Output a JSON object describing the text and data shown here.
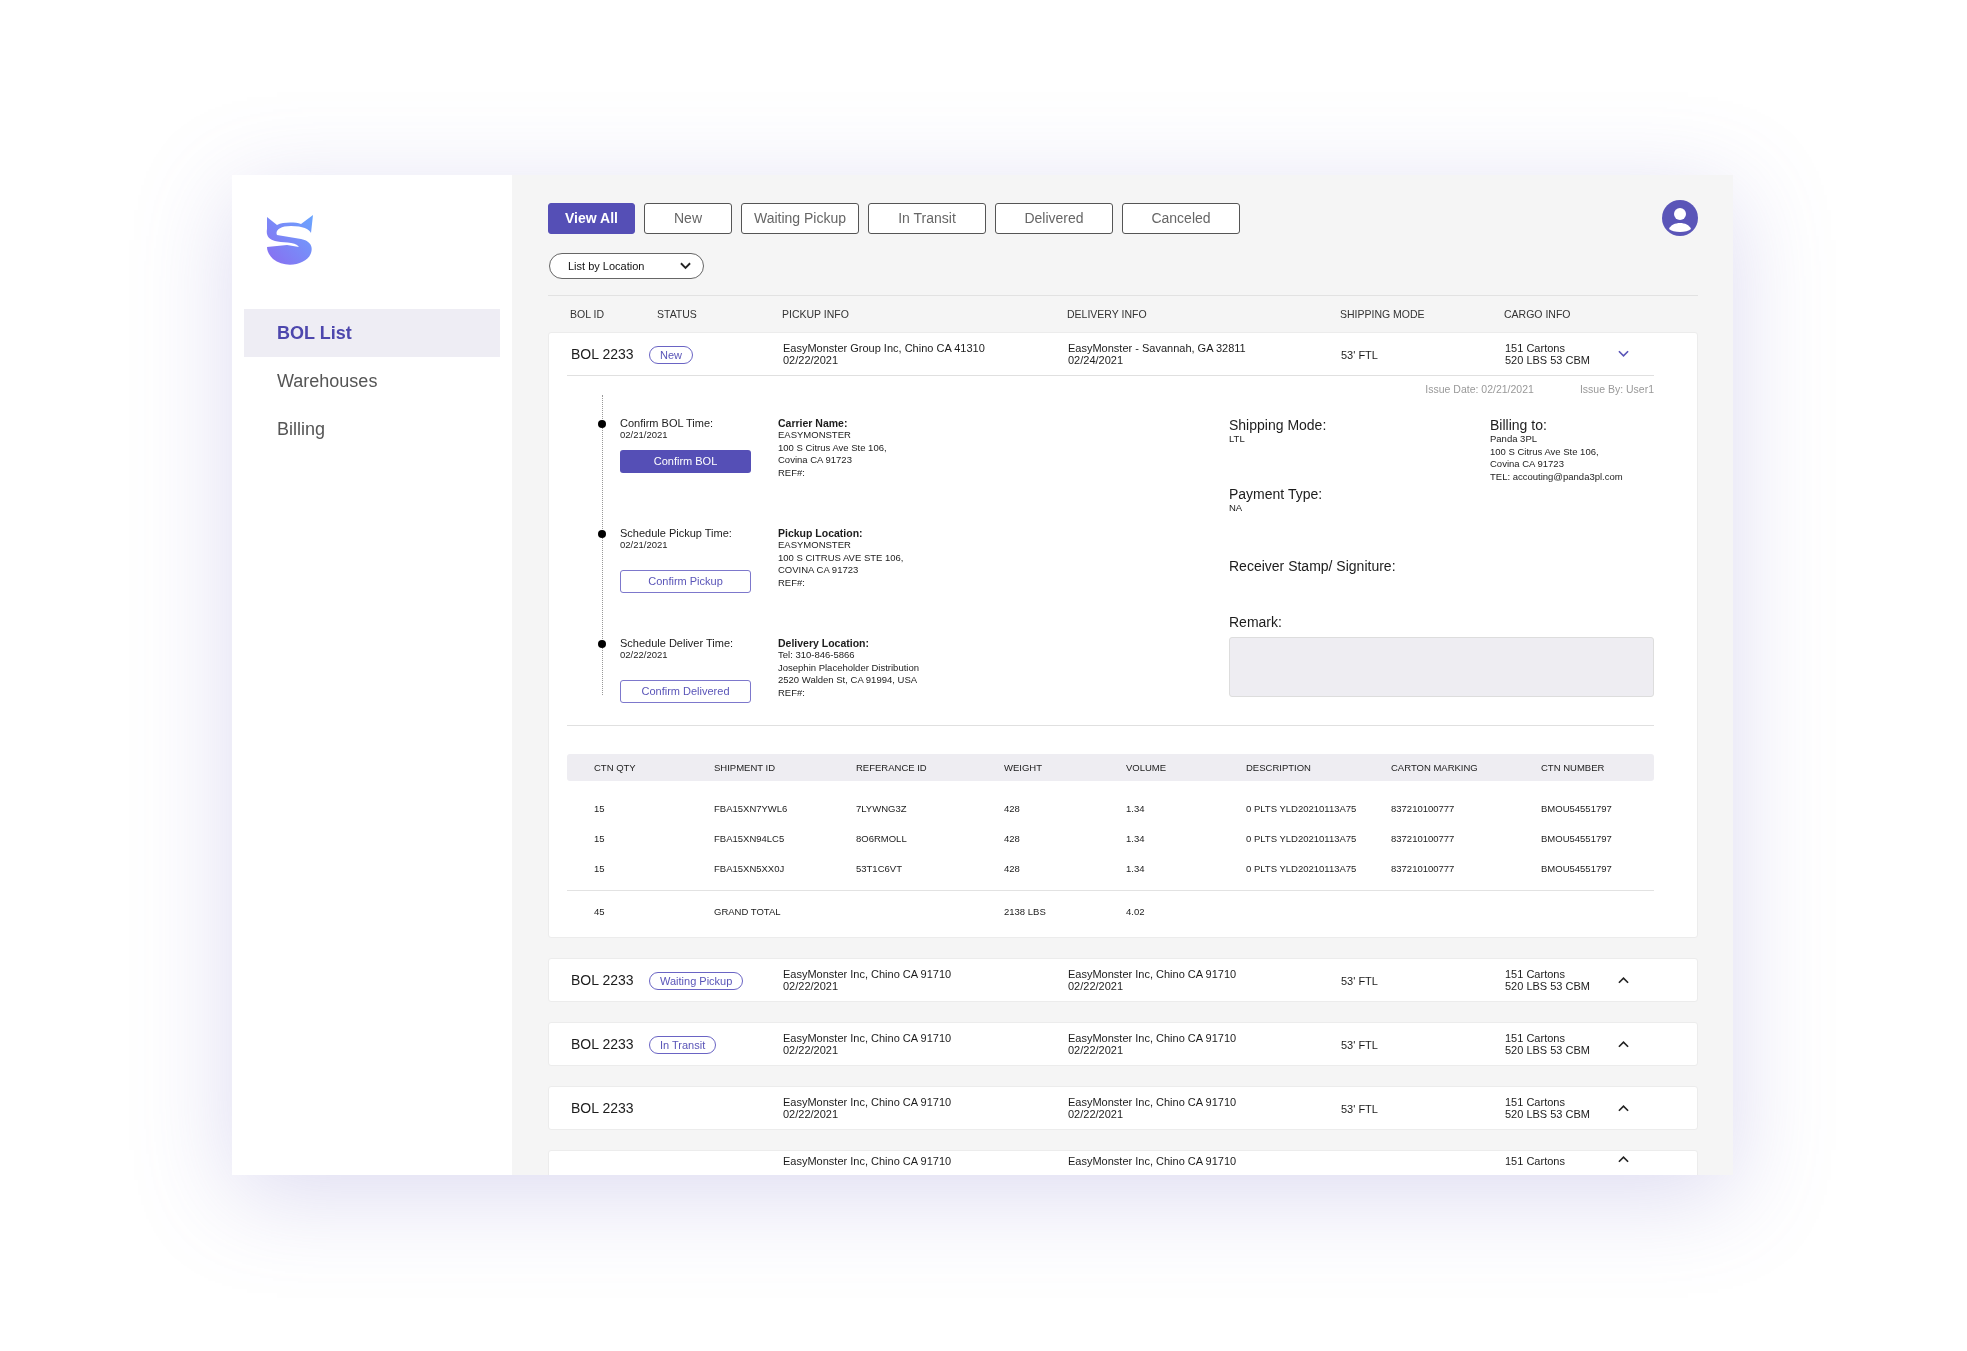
{
  "sidebar": {
    "items": [
      {
        "label": "BOL List",
        "selected": true
      },
      {
        "label": "Warehouses",
        "selected": false
      },
      {
        "label": "Billing",
        "selected": false
      }
    ]
  },
  "tabs": [
    {
      "label": "View All",
      "selected": true
    },
    {
      "label": "New",
      "selected": false
    },
    {
      "label": "Waiting Pickup",
      "selected": false
    },
    {
      "label": "In Transit",
      "selected": false
    },
    {
      "label": "Delivered",
      "selected": false
    },
    {
      "label": "Canceled",
      "selected": false
    }
  ],
  "dropdown": {
    "label": "List by Location"
  },
  "columns": [
    "BOL ID",
    "STATUS",
    "PICKUP INFO",
    "DELIVERY INFO",
    "SHIPPING MODE",
    "CARGO INFO"
  ],
  "bols": [
    {
      "id": "BOL 2233",
      "status": "New",
      "pickup": [
        "EasyMonster Group Inc,  Chino CA 41310",
        "02/22/2021"
      ],
      "delivery": [
        "EasyMonster - Savannah, GA 32811",
        "02/24/2021"
      ],
      "mode": "53' FTL",
      "cargo": [
        "151 Cartons",
        "520 LBS 53 CBM"
      ],
      "expanded": true
    },
    {
      "id": "BOL 2233",
      "status": "Waiting Pickup",
      "pickup": [
        "EasyMonster  Inc,  Chino CA 91710",
        "02/22/2021"
      ],
      "delivery": [
        "EasyMonster  Inc,  Chino CA 91710",
        "02/22/2021"
      ],
      "mode": "53' FTL",
      "cargo": [
        "151 Cartons",
        "520 LBS 53 CBM"
      ],
      "expanded": false
    },
    {
      "id": "BOL 2233",
      "status": "In Transit",
      "pickup": [
        "EasyMonster  Inc,  Chino CA 91710",
        "02/22/2021"
      ],
      "delivery": [
        "EasyMonster  Inc,  Chino CA 91710",
        "02/22/2021"
      ],
      "mode": "53' FTL",
      "cargo": [
        "151 Cartons",
        "520 LBS 53 CBM"
      ],
      "expanded": false
    },
    {
      "id": "BOL 2233",
      "pickup": [
        "EasyMonster  Inc,  Chino CA 91710",
        "02/22/2021"
      ],
      "delivery": [
        "EasyMonster  Inc,  Chino CA 91710",
        "02/22/2021"
      ],
      "mode": "53' FTL",
      "cargo": [
        "151 Cartons",
        "520 LBS 53 CBM"
      ],
      "expanded": false
    },
    {
      "pickup": [
        "EasyMonster  Inc,  Chino CA 91710"
      ],
      "delivery": [
        "EasyMonster  Inc,  Chino CA 91710"
      ],
      "cargo": [
        "151 Cartons"
      ],
      "expanded": false
    }
  ],
  "detail": {
    "issue_date": "Issue Date: 02/21/2021",
    "issue_by": "Issue By: User1",
    "steps": [
      {
        "label": "Confirm BOL Time:",
        "date": "02/21/2021",
        "button": "Confirm BOL",
        "kind": "filled",
        "info_title": "Carrier Name:",
        "info_lines": [
          "EASYMONSTER",
          "100 S Citrus Ave Ste 106,",
          "Covina CA 91723",
          "REF#:"
        ]
      },
      {
        "label": "Schedule Pickup Time:",
        "date": "02/21/2021",
        "button": "Confirm Pickup",
        "kind": "outline",
        "info_title": "Pickup Location:",
        "info_lines": [
          "EASYMONSTER",
          "100 S CITRUS AVE STE 106,",
          "COVINA CA 91723",
          "REF#:"
        ]
      },
      {
        "label": "Schedule Deliver Time:",
        "date": "02/22/2021",
        "button": "Confirm Delivered",
        "kind": "outline",
        "info_title": "Delivery Location:",
        "info_lines": [
          "Tel: 310-846-5866",
          "Josephin Placeholder Distribution",
          "2520  Walden St, CA 91994, USA",
          "REF#:"
        ]
      }
    ],
    "shipping_mode": {
      "label": "Shipping Mode:",
      "value": "LTL"
    },
    "payment_type": {
      "label": "Payment Type:",
      "value": "NA"
    },
    "billing": {
      "label": "Billing to:",
      "lines": [
        "Panda 3PL",
        "100 S Citrus Ave Ste 106,",
        "Covina CA 91723",
        "TEL: accouting@panda3pl.com"
      ]
    },
    "receiver": {
      "label": "Receiver Stamp/ Signiture:"
    },
    "remark": {
      "label": "Remark:"
    },
    "items": {
      "columns": [
        "CTN QTY",
        "SHIPMENT ID",
        "REFERANCE ID",
        "WEIGHT",
        "VOLUME",
        "DESCRIPTION",
        "CARTON MARKING",
        "CTN NUMBER"
      ],
      "rows": [
        [
          "15",
          "FBA15XN7YWL6",
          "7LYWNG3Z",
          "428",
          "1.34",
          "0 PLTS YLD20210113A75",
          "837210100777",
          "BMOU54551797"
        ],
        [
          "15",
          "FBA15XN94LC5",
          "8O6RMOLL",
          "428",
          "1.34",
          "0 PLTS YLD20210113A75",
          "837210100777",
          "BMOU54551797"
        ],
        [
          "15",
          "FBA15XN5XX0J",
          "53T1C6VT",
          "428",
          "1.34",
          "0 PLTS YLD20210113A75",
          "837210100777",
          "BMOU54551797"
        ]
      ],
      "total": {
        "ctn_qty": "45",
        "shipment_id": "GRAND TOTAL",
        "weight": "2138 LBS",
        "volume": "4.02"
      }
    }
  }
}
